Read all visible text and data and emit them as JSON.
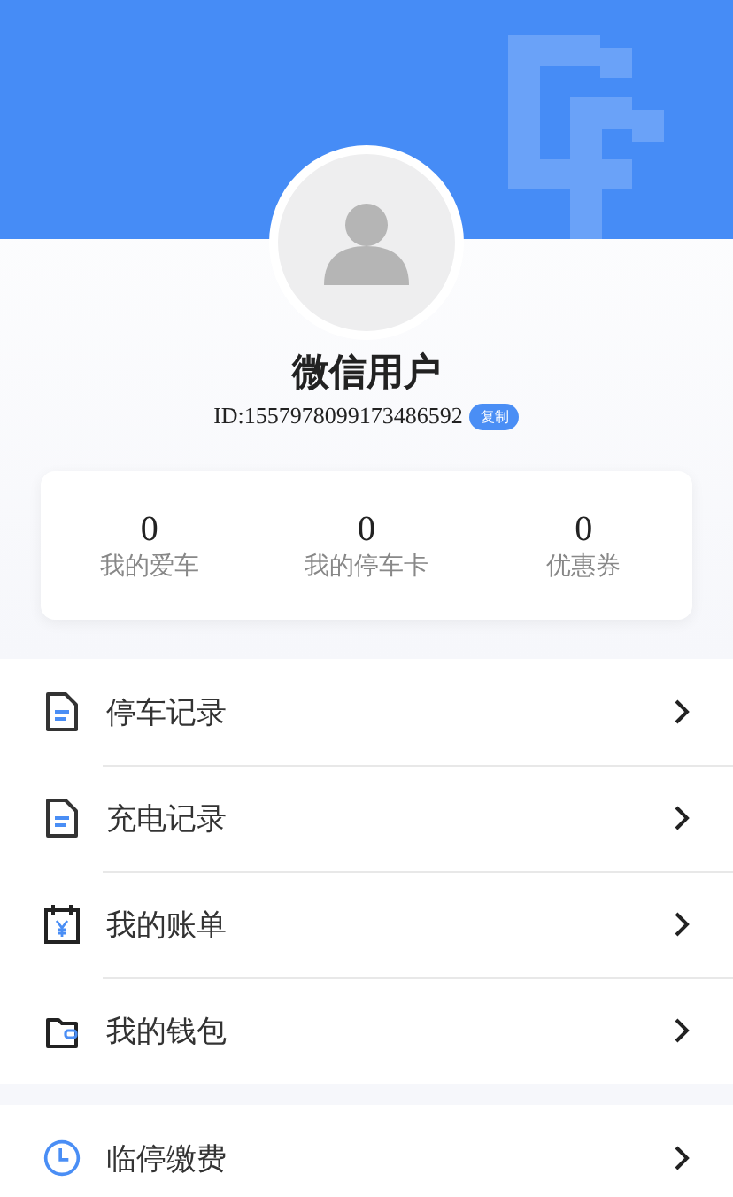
{
  "profile": {
    "name": "微信用户",
    "id": "ID:1557978099173486592",
    "copy_button": "复制"
  },
  "stats": [
    {
      "value": "0",
      "label": "我的爱车"
    },
    {
      "value": "0",
      "label": "我的停车卡"
    },
    {
      "value": "0",
      "label": "优惠券"
    }
  ],
  "menu_groups": [
    [
      {
        "kind": "document",
        "label": "停车记录"
      },
      {
        "kind": "document",
        "label": "充电记录"
      },
      {
        "kind": "bill",
        "label": "我的账单"
      },
      {
        "kind": "wallet",
        "label": "我的钱包"
      }
    ],
    [
      {
        "kind": "clock",
        "label": "临停缴费"
      }
    ]
  ]
}
